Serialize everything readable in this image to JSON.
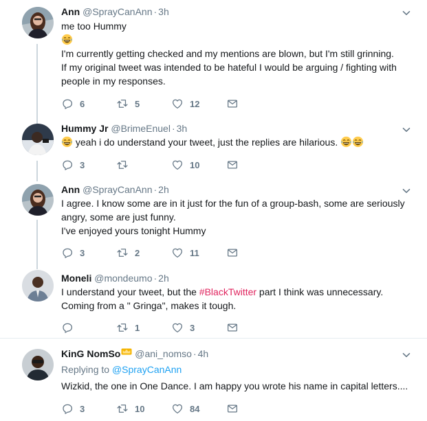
{
  "tweets": [
    {
      "name": "Ann",
      "handle": "@SprayCanAnn",
      "time": "3h",
      "lines": [
        "me too Hummy",
        "I'm currently getting checked and my mentions are blown, but I'm still grinning.",
        "If my original tweet was intended to be hateful I would be arguing / fighting with",
        "people in my responses."
      ],
      "reply_count": "6",
      "retweet_count": "5",
      "like_count": "12"
    },
    {
      "name": "Hummy Jr",
      "handle": "@BrimeEnuel",
      "time": "3h",
      "lines": [
        "yeah i do understand your tweet, just the replies are hilarious."
      ],
      "reply_count": "3",
      "retweet_count": "",
      "like_count": "10"
    },
    {
      "name": "Ann",
      "handle": "@SprayCanAnn",
      "time": "2h",
      "lines": [
        "I agree. I know some are in it just for the fun of a group-bash, some are seriously",
        "angry, some are just funny.",
        "I've enjoyed yours tonight Hummy"
      ],
      "reply_count": "3",
      "retweet_count": "2",
      "like_count": "11"
    },
    {
      "name": "Moneli",
      "handle": "@mondeumo",
      "time": "2h",
      "line1_pre": "I understand your tweet, but the ",
      "hashtag": "#BlackTwitter",
      "line1_post": " part I think was unnecessary.",
      "line2": "Coming from a \" Gringa\", makes it tough.",
      "reply_count": "",
      "retweet_count": "1",
      "like_count": "3"
    },
    {
      "name": "KinG NomSo",
      "handle": "@ani_nomso",
      "time": "4h",
      "replying_prefix": "Replying to",
      "replying_to": "@SprayCanAnn",
      "lines": [
        "Wizkid, the one in One Dance. I am happy you wrote his name in capital letters...."
      ],
      "reply_count": "3",
      "retweet_count": "10",
      "like_count": "84"
    }
  ],
  "colors": {
    "link_pink": "#e0245e",
    "link_blue": "#1da1f2",
    "muted": "#657786",
    "thread": "#ccd6dd"
  },
  "icons": [
    "reply-icon",
    "retweet-icon",
    "like-icon",
    "message-icon",
    "chevron-down-icon",
    "laughing-emoji-icon",
    "crown-emoji-icon"
  ]
}
